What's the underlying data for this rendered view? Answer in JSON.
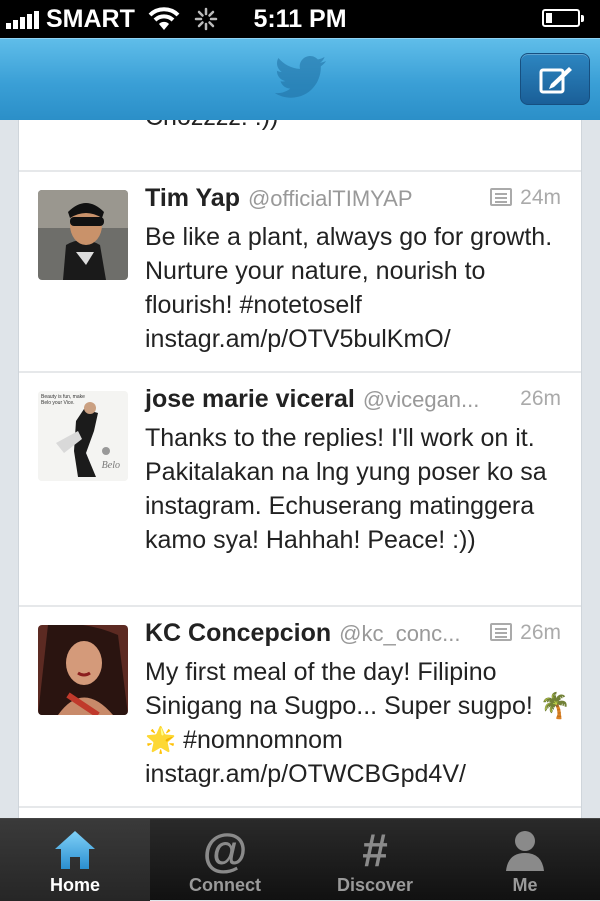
{
  "status_bar": {
    "carrier": "SMART",
    "time": "5:11 PM",
    "icons": [
      "signal-bars-icon",
      "wifi-icon",
      "activity-spinner-icon",
      "battery-icon"
    ],
    "battery_level": 0.2
  },
  "nav_bar": {
    "logo_icon": "twitter-bird-icon",
    "compose_icon": "compose-tweet-icon",
    "accent": "#3a9fd6"
  },
  "timeline": {
    "partial_tweet": {
      "text": "Chozzzz!  :))"
    },
    "tweets": [
      {
        "name": "Tim Yap",
        "handle": "@officialTIMYAP",
        "has_media": true,
        "time": "24m",
        "text": "Be like a plant, always go for growth. Nurture your nature, nourish to flourish! #notetoself instagr.am/p/OTV5bulKmO/"
      },
      {
        "name": "jose marie viceral",
        "handle": "@vicegan...",
        "has_media": false,
        "time": "26m",
        "text": "Thanks to the replies! I'll work on it. Pakitalakan na lng yung poser ko sa instagram. Echuserang matinggera kamo sya! Hahhah! Peace! :))",
        "avatar_caption": "Beauty is fun, make Belo your Vice.",
        "avatar_brand": "Belo"
      },
      {
        "name": "KC Concepcion",
        "handle": "@kc_conc...",
        "has_media": true,
        "time": "26m",
        "text": "My first meal of the day! Filipino Sinigang na Sugpo... Super sugpo! 🌴 🌟 #nomnomnom instagr.am/p/OTWCBGpd4V/"
      }
    ]
  },
  "tab_bar": {
    "tabs": [
      {
        "label": "Home",
        "icon": "home-icon",
        "active": true
      },
      {
        "label": "Connect",
        "icon": "at-icon",
        "glyph": "@",
        "active": false
      },
      {
        "label": "Discover",
        "icon": "hashtag-icon",
        "glyph": "#",
        "active": false
      },
      {
        "label": "Me",
        "icon": "person-icon",
        "active": false
      }
    ]
  }
}
